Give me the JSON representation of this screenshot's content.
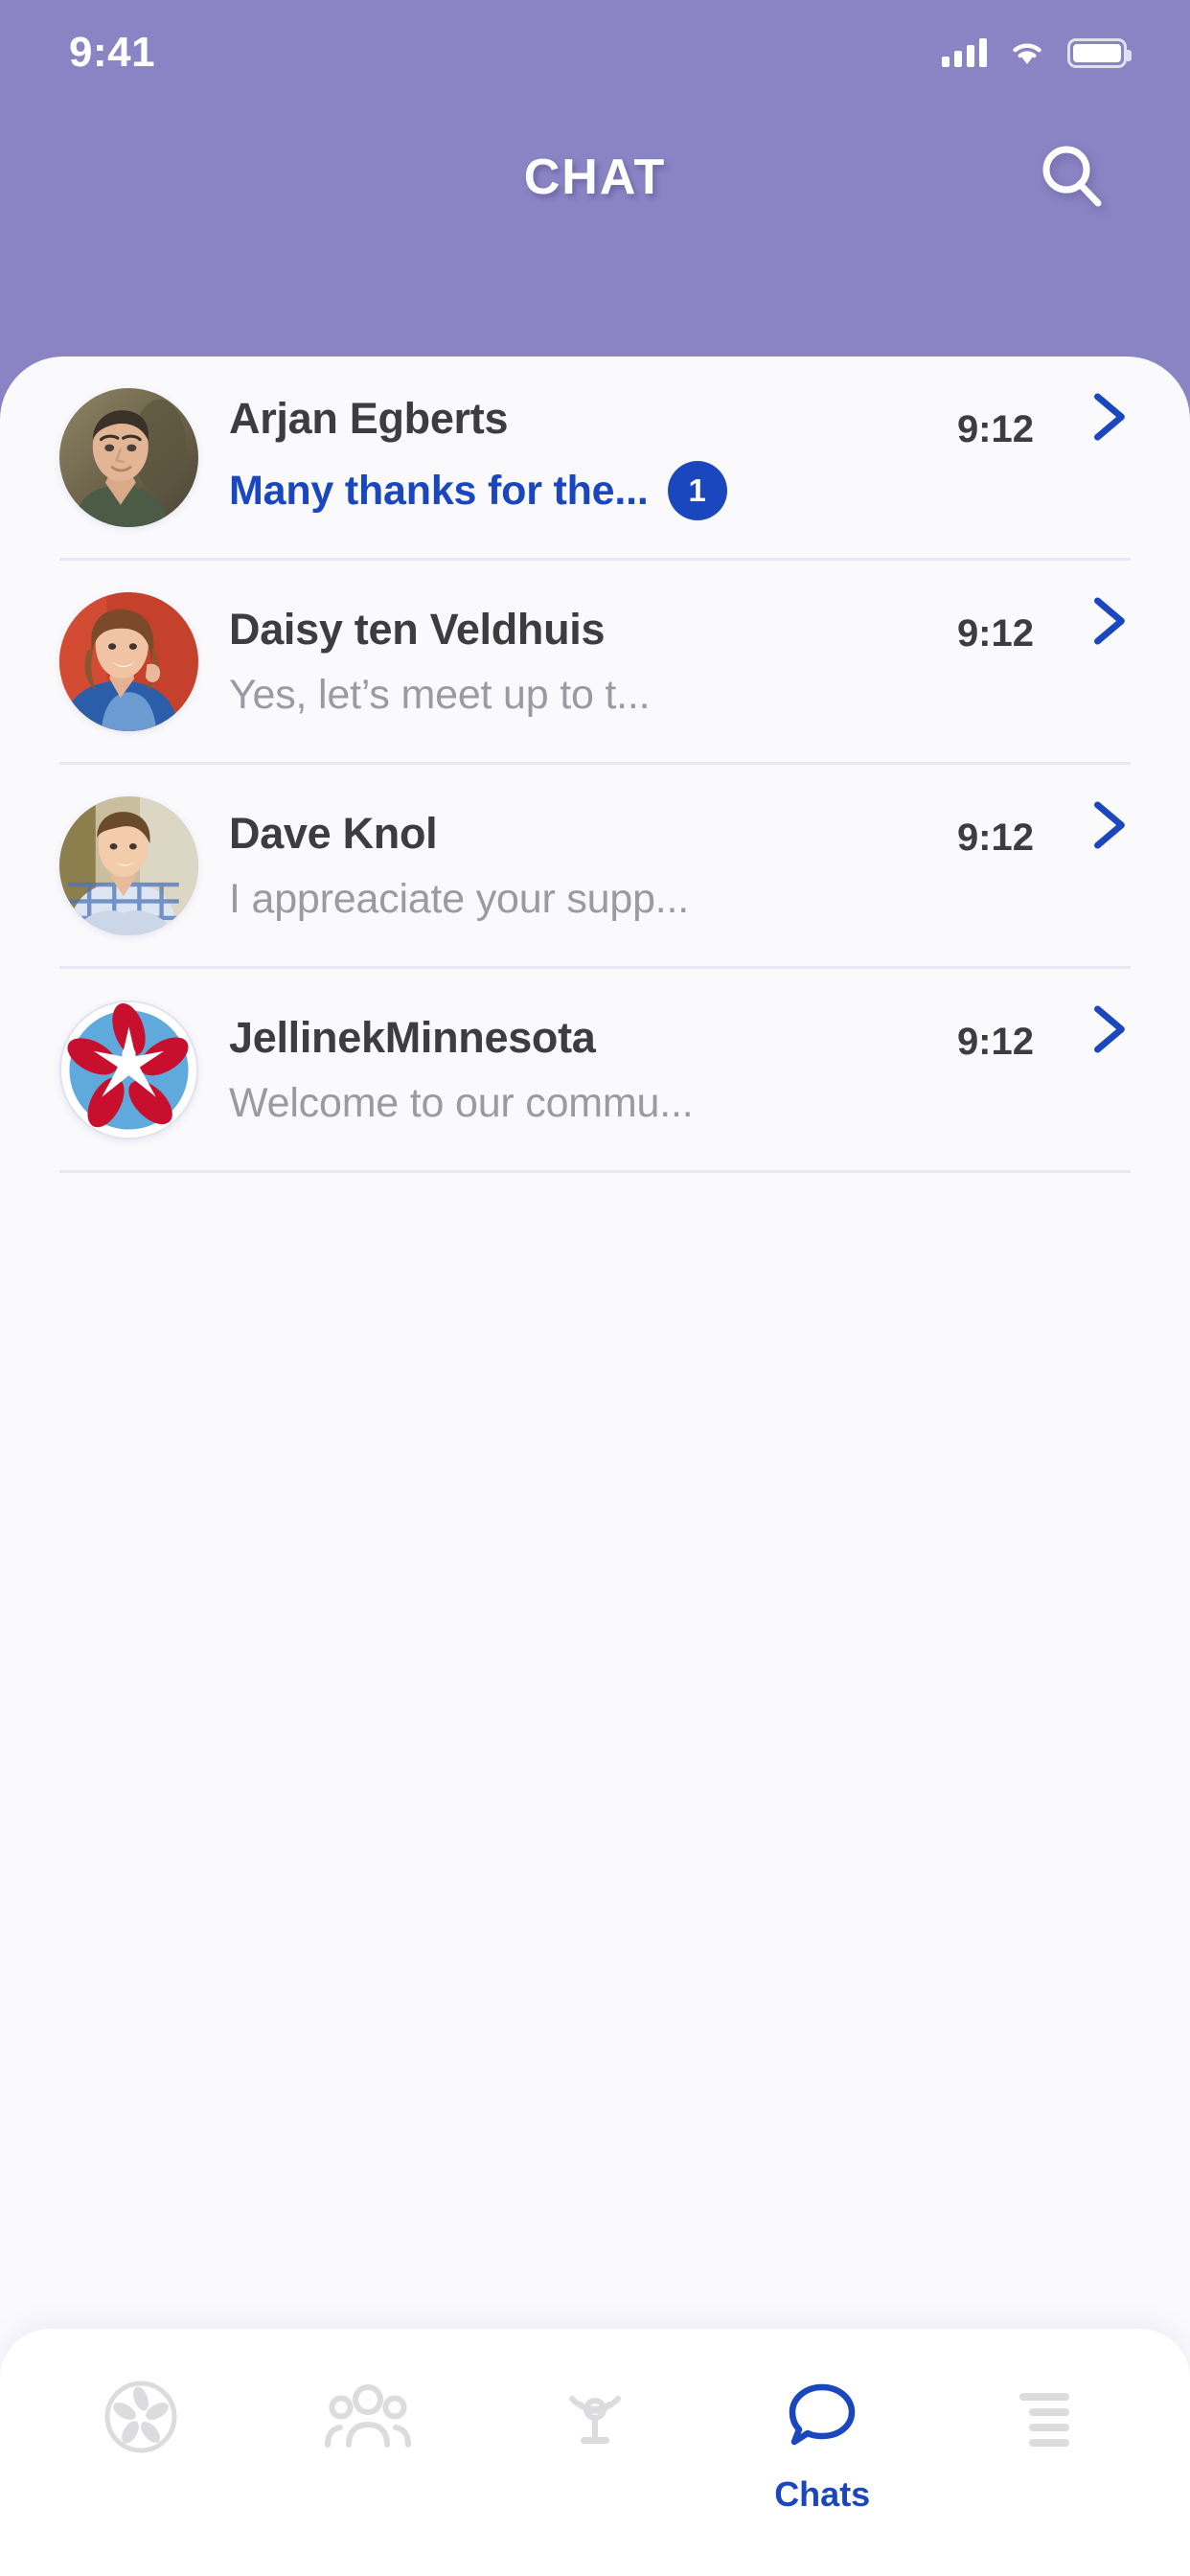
{
  "statusbar": {
    "time": "9:41",
    "signal_icon": "cellular-signal-icon",
    "wifi_icon": "wifi-icon",
    "battery_icon": "battery-icon"
  },
  "header": {
    "title": "CHAT",
    "search_icon": "search-icon",
    "background_color": "#8B84C4"
  },
  "colors": {
    "accent_purple": "#8B84C4",
    "accent_blue": "#1A46BE",
    "card_background": "#FAFAFD",
    "divider": "#E9E8F2",
    "name_text": "#3D3D40",
    "preview_text": "#9A9AA0"
  },
  "chats": [
    {
      "name": "Arjan Egberts",
      "preview": "Many thanks for the...",
      "time": "9:12",
      "unread": true,
      "badge": "1",
      "avatar": "photo-man-green-jacket",
      "chevron_icon": "chevron-right-icon"
    },
    {
      "name": "Daisy ten Veldhuis",
      "preview": "Yes, let’s meet up to t...",
      "time": "9:12",
      "unread": false,
      "badge": "",
      "avatar": "photo-woman-red-background",
      "chevron_icon": "chevron-right-icon"
    },
    {
      "name": "Dave Knol",
      "preview": "I appreaciate your supp...",
      "time": "9:12",
      "unread": false,
      "badge": "",
      "avatar": "photo-man-plaid-shirt",
      "chevron_icon": "chevron-right-icon"
    },
    {
      "name": "JellinekMinnesota",
      "preview": "Welcome to our commu...",
      "time": "9:12",
      "unread": false,
      "badge": "",
      "avatar": "logo-jellinek-star",
      "chevron_icon": "chevron-right-icon"
    }
  ],
  "tabbar": {
    "items": [
      {
        "icon": "flower-logo-icon",
        "label": "",
        "active": false
      },
      {
        "icon": "group-people-icon",
        "label": "",
        "active": false
      },
      {
        "icon": "broadcast-icon",
        "label": "",
        "active": false
      },
      {
        "icon": "chat-bubble-icon",
        "label": "Chats",
        "active": true
      },
      {
        "icon": "menu-list-icon",
        "label": "",
        "active": false
      }
    ]
  }
}
